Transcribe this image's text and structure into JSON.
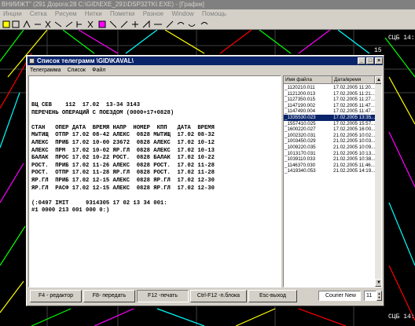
{
  "app": {
    "title": "ВНИИЖТ\" (291 Дорога:28 C:\\GID\\EXE_291\\DSP32TKI.EXE) - [График]",
    "menu": [
      "Инции",
      "Сетка",
      "Рисуем",
      "Нитки",
      "Пометки",
      "Разное",
      "Window",
      "Помощь"
    ]
  },
  "graph": {
    "labels": [
      "15",
      "СЦБ 14:",
      "СЦБ 14:"
    ]
  },
  "dialog": {
    "title": "Список телеграмм \\GID\\KAVAL\\",
    "menu": [
      "Телеграмма",
      "Список",
      "Файл"
    ],
    "controls": {
      "minimize": "_",
      "maximize": "□",
      "close": "×"
    },
    "telegram_lines": [
      "ВЦ СЕВ    112  17.02  13-34 3143",
      "ПЕРЕЧЕНЬ ОПЕРАЦИЙ С ПОЕЗДОМ (0000+17+0828)",
      "",
      "СТАН   ОПЕР ДАТА  ВРЕМЯ НАПР  НОМЕР  КПП   ДАТА  ВРЕМЯ",
      "МЫТИЩ  ОТПР 17.02 08-42 АЛЕКС  0828 МЫТИЩ  17.02 08-32",
      "АЛЕКС  ПРИБ 17.02 10-00 23672  0828 АЛЕКС  17.02 10-12",
      "АЛЕКС  ПРМ  17.02 10-02 ЯР.ГЛ  0828 АЛЕКС  17.02 10-13",
      "БАЛАК  ПРОС 17.02 10-22 РОСТ.  0828 БАЛАК  17.02 10-22",
      "РОСТ.  ПРИБ 17.02 11-26 АЛЕКС  0828 РОСТ.  17.02 11-28",
      "РОСТ.  ОТПР 17.02 11-28 ЯР.ГЛ  0828 РОСТ.  17.02 11-28",
      "ЯР.ГЛ  ПРИБ 17.02 12-15 АЛЕКС  0828 ЯР.ГЛ  17.02 12-30",
      "ЯР.ГЛ  РАСФ 17.02 12-15 АЛЕКС  0828 ЯР.ГЛ  17.02 12-30",
      "",
      "(:0497 IМIТ     9314305 17 02 13 34 001:",
      "#1 0000 213 001 000 0:)"
    ],
    "file_list": {
      "col_name": "Имя файла",
      "col_date": "Дата/время",
      "selected_index": 5,
      "rows": [
        {
          "name": "_1120210.011",
          "date": "17.02.2005 11:20..."
        },
        {
          "name": "_1121200.013",
          "date": "17.02.2005 11:21..."
        },
        {
          "name": "_1127350.015",
          "date": "17.02.2005 11:27..."
        },
        {
          "name": "_1147190.002",
          "date": "17.02.2005 11:47..."
        },
        {
          "name": "_1147490.004",
          "date": "17.02.2005 11:47..."
        },
        {
          "name": "_1335530.023",
          "date": "17.02.2005 13:35..."
        },
        {
          "name": "_1557410.025",
          "date": "17.02.2005 15:57..."
        },
        {
          "name": "_1600220.027",
          "date": "17.02.2005 16:00..."
        },
        {
          "name": "_1002320.031",
          "date": "21.02.2005 10:02..."
        },
        {
          "name": "_1003450.029",
          "date": "21.02.2005 10:03..."
        },
        {
          "name": "_1009220.035",
          "date": "21.02.2005 10:09..."
        },
        {
          "name": "_1013170.031",
          "date": "21.02.2005 10:13..."
        },
        {
          "name": "_1039110.033",
          "date": "21.02.2005 10:38..."
        },
        {
          "name": "_1146370.030",
          "date": "21.02.2005 11:46..."
        },
        {
          "name": "_1419340.053",
          "date": "21.02.2005 14:19..."
        }
      ]
    },
    "buttons": {
      "editor": "F4 - редактор",
      "send": "F8- передать",
      "print": "F12 -печать",
      "print_block": "Ctrl-F12 -п.блока",
      "exit": "Esc-выход"
    },
    "font": {
      "name": "Courier New",
      "size": "11"
    }
  }
}
